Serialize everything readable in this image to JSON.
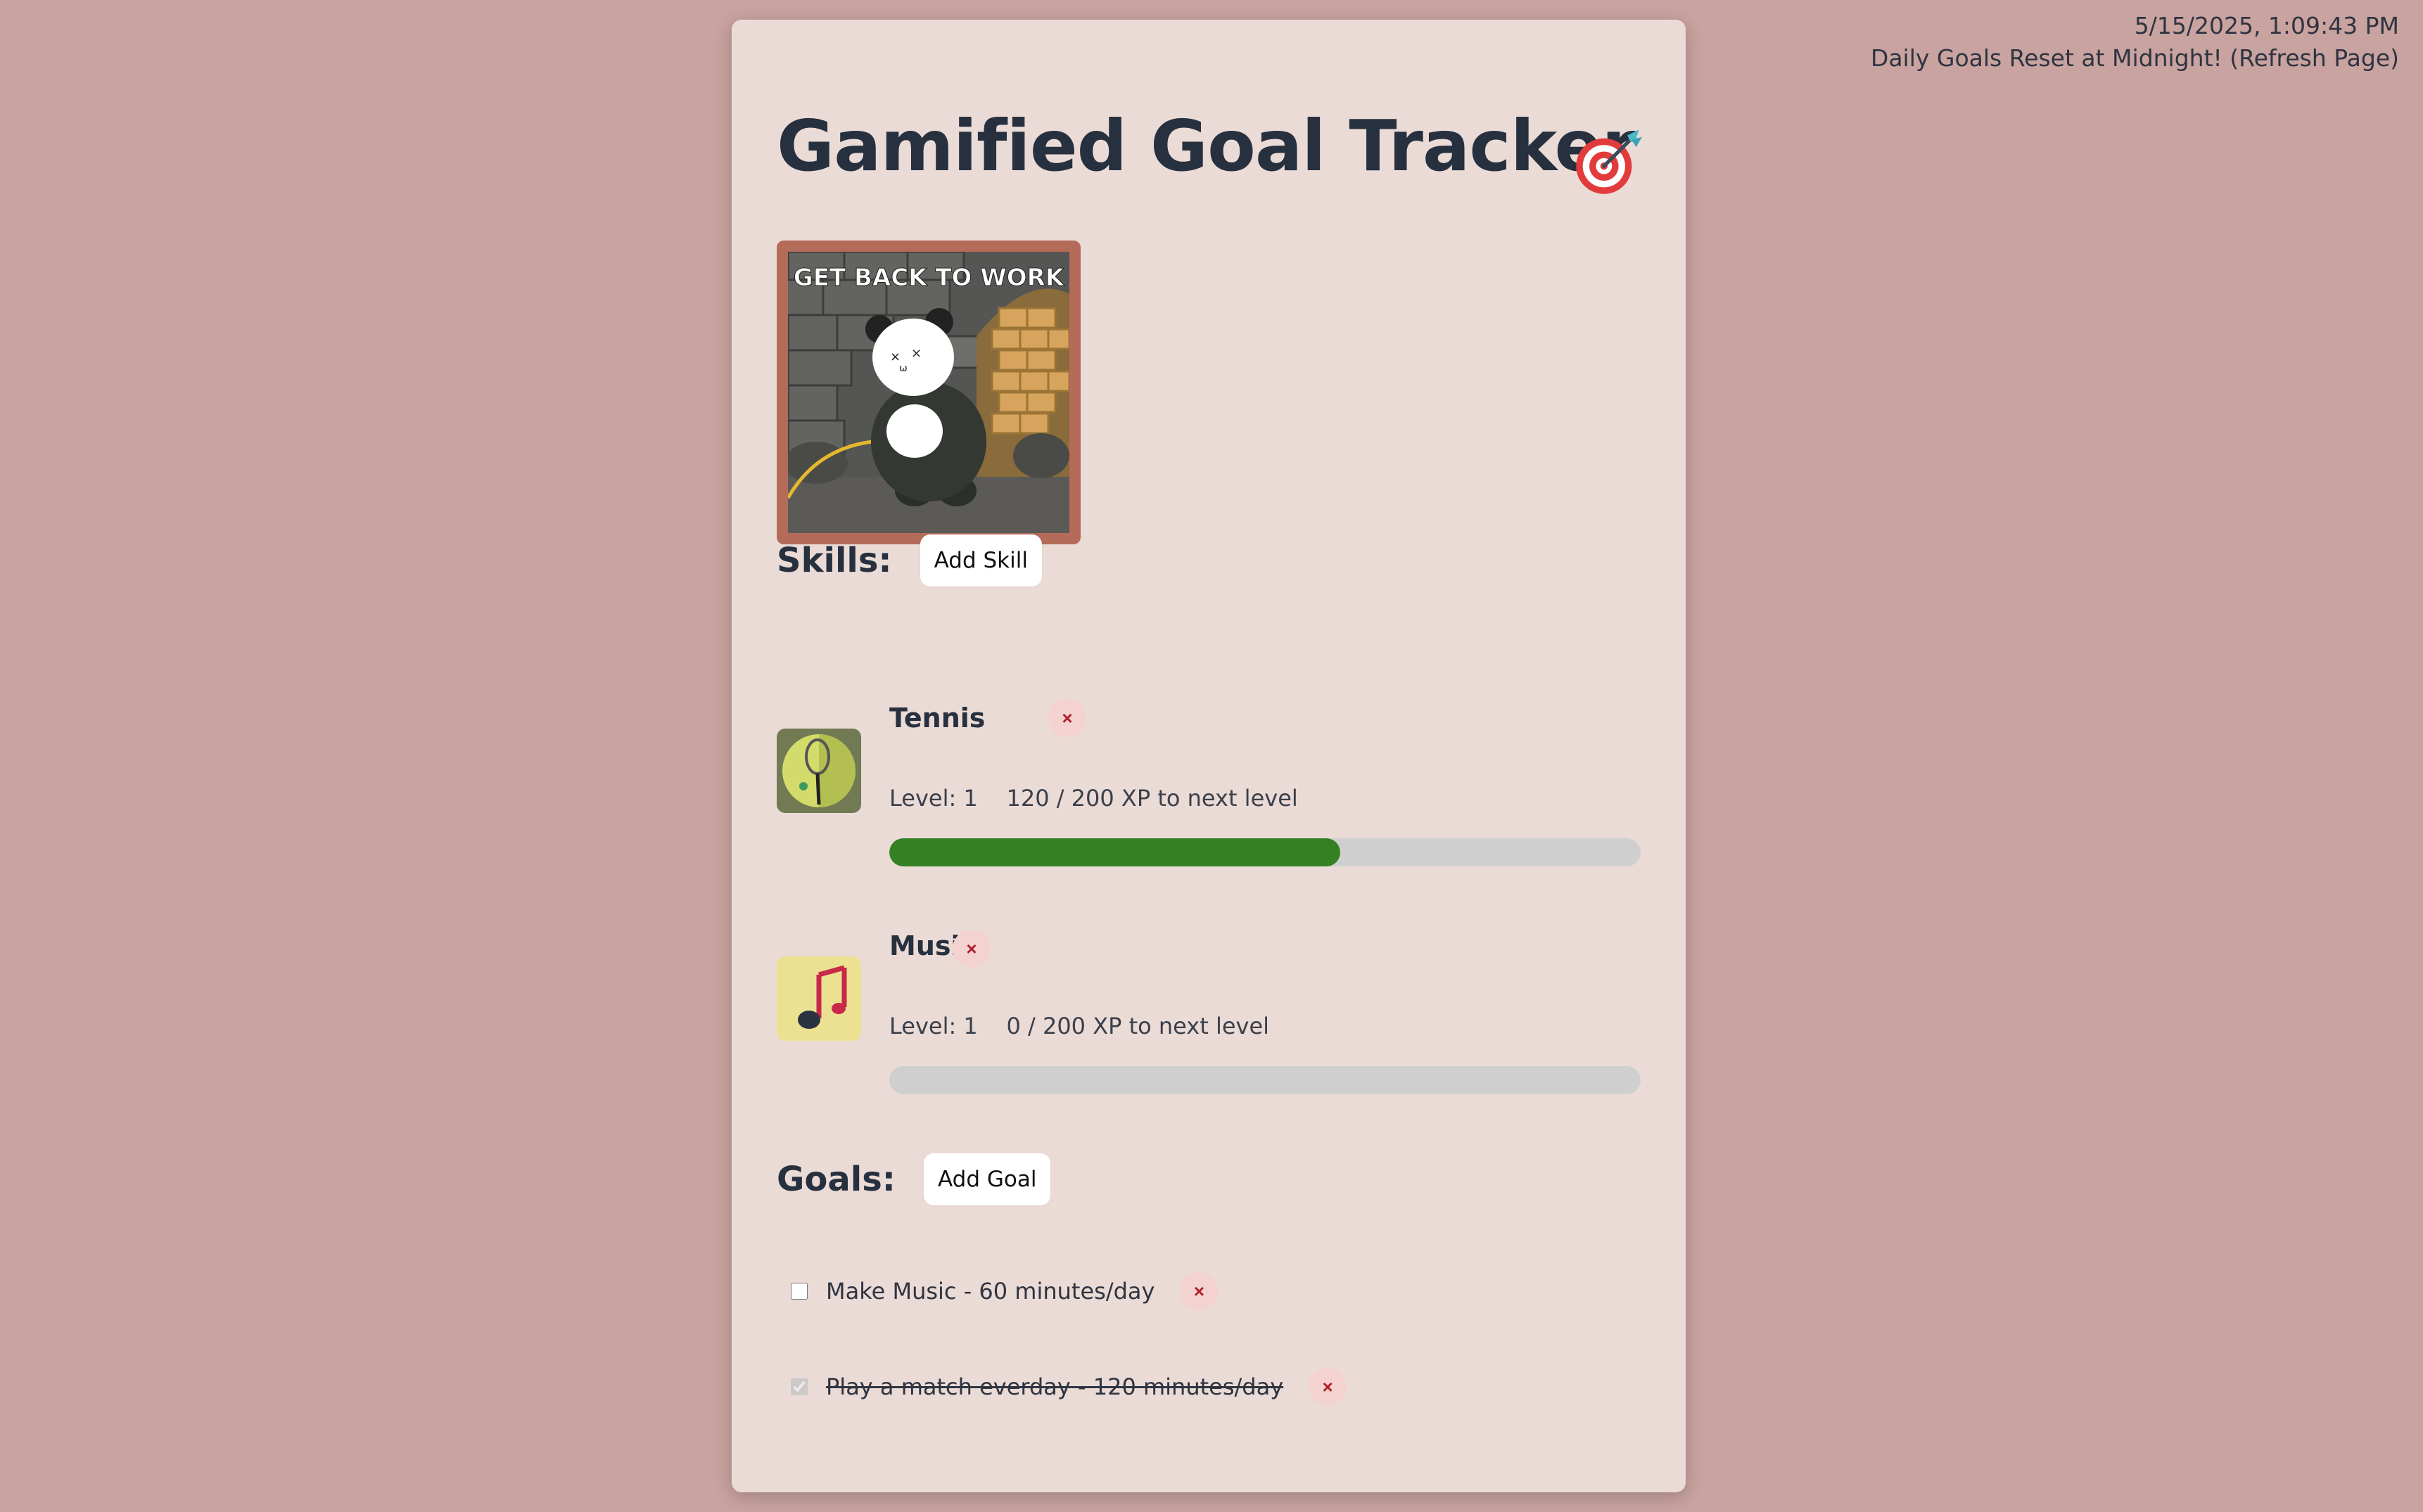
{
  "header": {
    "datetime": "5/15/2025, 1:09:43 PM",
    "reset_notice": "Daily Goals Reset at Midnight! (Refresh Page)"
  },
  "app": {
    "title": "Gamified Goal Tracker",
    "title_icon": "target-dart-icon"
  },
  "avatar": {
    "caption": "GET BACK TO WORK"
  },
  "skills_section": {
    "heading": "Skills:",
    "add_label": "Add Skill",
    "items": [
      {
        "name": "Tennis",
        "icon": "tennis-racket-icon",
        "level_text": "Level: 1",
        "xp_text": "120 / 200 XP to next level",
        "progress": 0.6,
        "remove_label": "×"
      },
      {
        "name": "Music",
        "icon": "music-note-icon",
        "level_text": "Level: 1",
        "xp_text": "0 / 200 XP to next level",
        "progress": 0.0,
        "remove_label": "×"
      }
    ]
  },
  "goals_section": {
    "heading": "Goals:",
    "add_label": "Add Goal",
    "items": [
      {
        "text": "Make Music - 60 minutes/day",
        "completed": false,
        "remove_label": "×"
      },
      {
        "text": "Play a match everday - 120 minutes/day",
        "completed": true,
        "remove_label": "×"
      }
    ]
  },
  "colors": {
    "page_background": "#c9a3a0",
    "card_background": "#ebdbd6",
    "progress_fill": "#348023",
    "progress_track": "#cfcfcf",
    "avatar_frame": "#b56b5a",
    "remove_button_bg": "#f3d2d0",
    "remove_button_fg": "#b11e2a"
  }
}
